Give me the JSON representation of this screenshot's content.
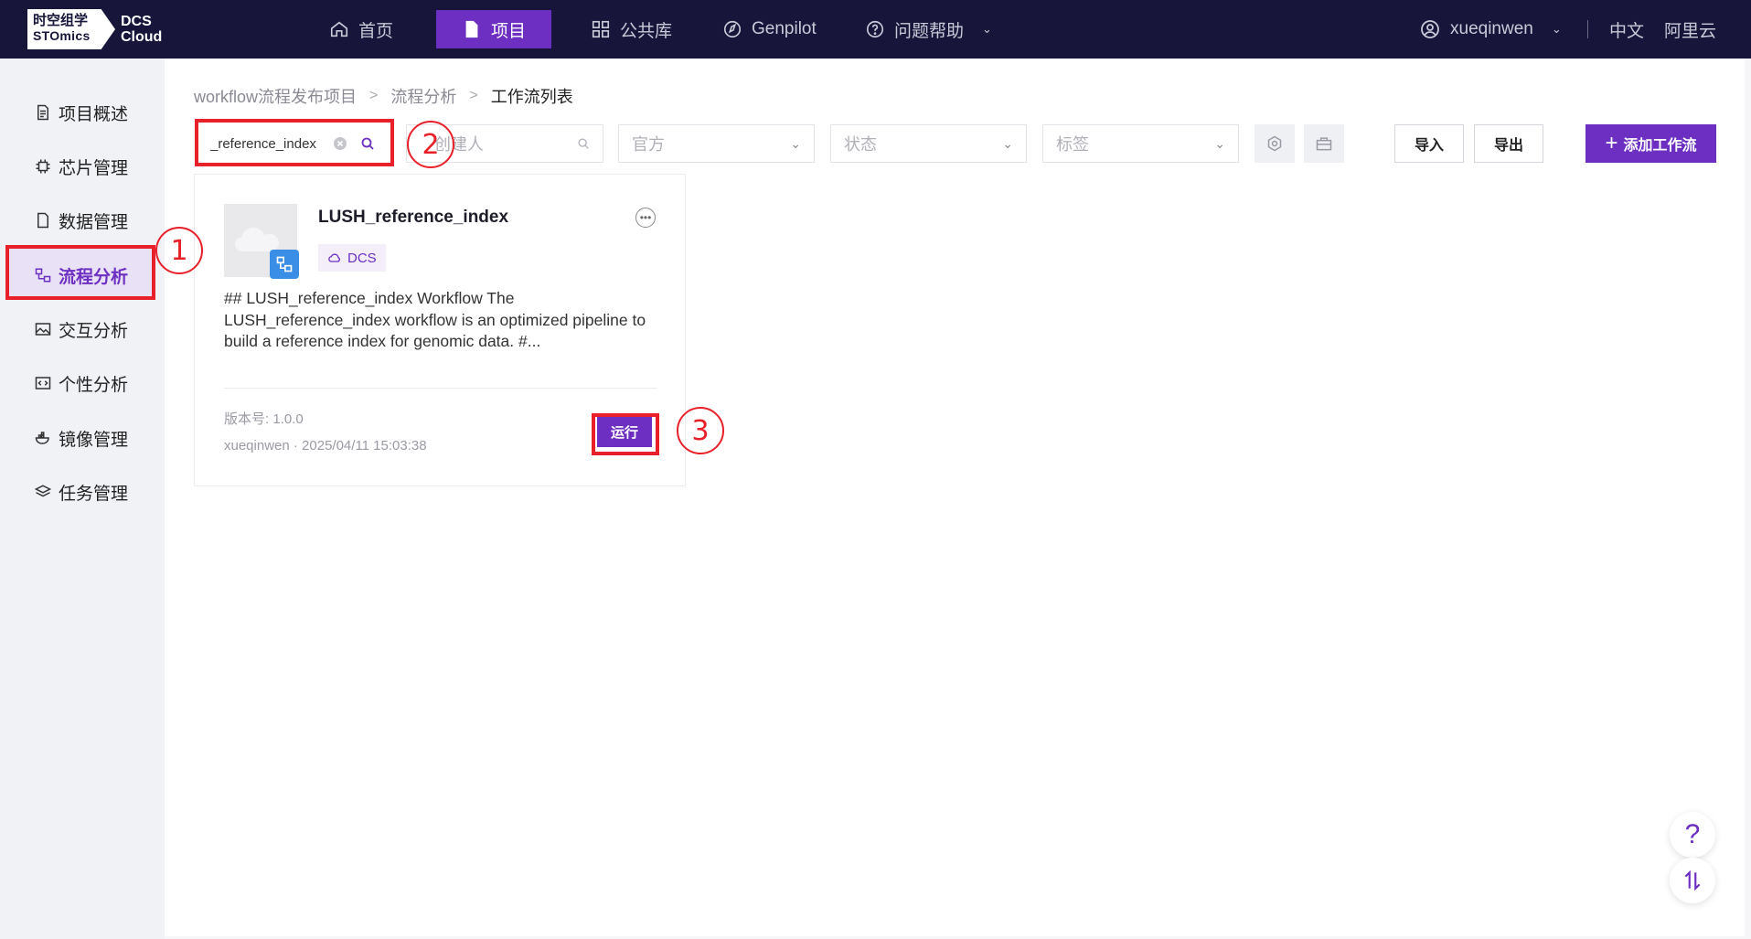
{
  "topnav": {
    "logo_cn": "时空组学",
    "logo_en": "STOmics",
    "logo_product_line1": "DCS",
    "logo_product_line2": "Cloud",
    "items": [
      {
        "label": "首页",
        "icon": "home-icon",
        "active": false
      },
      {
        "label": "项目",
        "icon": "file-icon",
        "active": true
      },
      {
        "label": "公共库",
        "icon": "grid-icon",
        "active": false
      },
      {
        "label": "Genpilot",
        "icon": "compass-icon",
        "active": false
      },
      {
        "label": "问题帮助",
        "icon": "help-icon",
        "active": false
      }
    ],
    "user": "xueqinwen",
    "lang": "中文",
    "cloud": "阿里云"
  },
  "sidebar": {
    "items": [
      {
        "label": "项目概述",
        "icon": "doc-icon"
      },
      {
        "label": "芯片管理",
        "icon": "chip-icon"
      },
      {
        "label": "数据管理",
        "icon": "file-data-icon"
      },
      {
        "label": "流程分析",
        "icon": "workflow-icon",
        "active": true
      },
      {
        "label": "交互分析",
        "icon": "image-icon"
      },
      {
        "label": "个性分析",
        "icon": "code-icon"
      },
      {
        "label": "镜像管理",
        "icon": "docker-icon"
      },
      {
        "label": "任务管理",
        "icon": "layers-icon"
      }
    ]
  },
  "breadcrumb": [
    "workflow流程发布项目",
    "流程分析",
    "工作流列表"
  ],
  "filters": {
    "search_value": "_reference_index",
    "creator_placeholder": "创建人",
    "official_placeholder": "官方",
    "status_placeholder": "状态",
    "tag_placeholder": "标签"
  },
  "actions": {
    "import": "导入",
    "export": "导出",
    "add": "添加工作流"
  },
  "card": {
    "title": "LUSH_reference_index",
    "tag": "DCS",
    "description": "## LUSH_reference_index Workflow The LUSH_reference_index workflow is an optimized pipeline to build a reference index for genomic data. #...",
    "version": "版本号: 1.0.0",
    "author_time": "xueqinwen · 2025/04/11 15:03:38",
    "run": "运行"
  },
  "annotations": [
    "1",
    "2",
    "3"
  ],
  "colors": {
    "accent": "#6d2fc1",
    "topbar": "#17163a",
    "highlight": "#e8202a"
  }
}
